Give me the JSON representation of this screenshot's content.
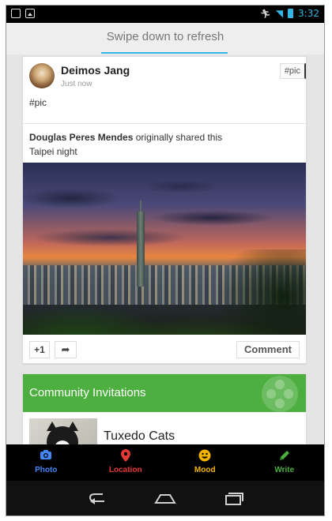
{
  "statusbar": {
    "time": "3:32",
    "icons": [
      "screen-icon",
      "image-icon",
      "running-icon",
      "wifi-icon",
      "battery-icon"
    ]
  },
  "refresh": {
    "label": "Swipe down to refresh",
    "accent": "#33b5e5"
  },
  "post": {
    "author": "Deimos Jang",
    "time": "Just now",
    "tag": "#pic",
    "text": "#pic",
    "shared_by": "Douglas Peres Mendes",
    "shared_suffix": "originally shared this",
    "caption": "Taipei night",
    "plus_one": "+1",
    "comment_label": "Comment"
  },
  "community": {
    "title": "Community Invitations",
    "name": "Tuxedo Cats",
    "header_color": "#4caf3f"
  },
  "bottombar": {
    "items": [
      {
        "label": "Photo",
        "color": "#4285f4",
        "icon": "camera-icon"
      },
      {
        "label": "Location",
        "color": "#e53935",
        "icon": "location-pin-icon"
      },
      {
        "label": "Mood",
        "color": "#f4b400",
        "icon": "smiley-icon"
      },
      {
        "label": "Write",
        "color": "#4caf3f",
        "icon": "pencil-icon"
      }
    ]
  }
}
